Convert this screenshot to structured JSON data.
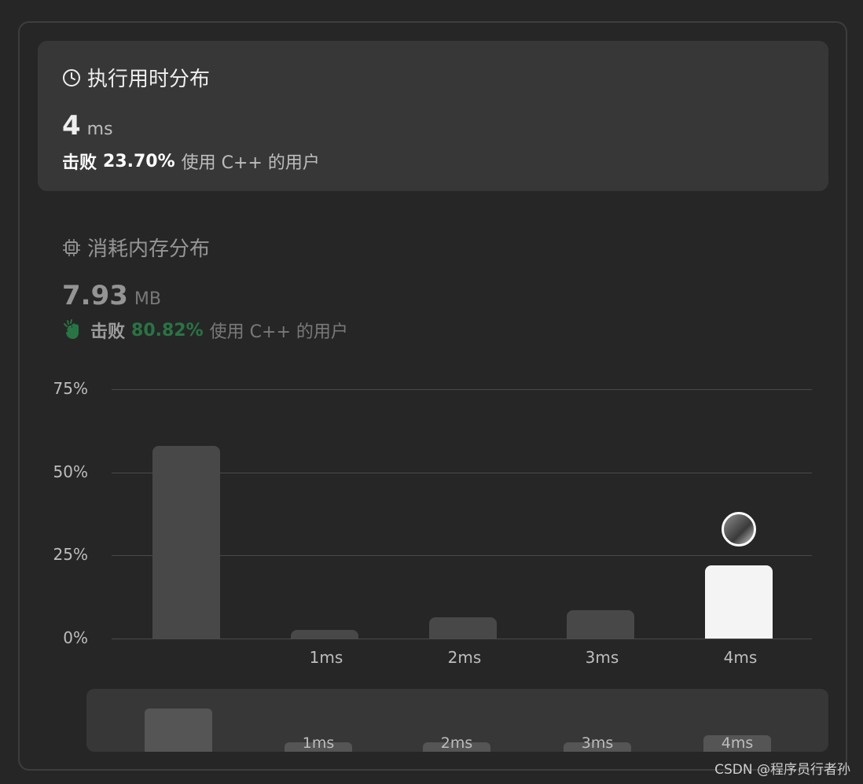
{
  "runtime": {
    "title": "执行用时分布",
    "icon": "clock-icon",
    "value": "4",
    "unit": "ms",
    "beat_label": "击败",
    "beat_percent": "23.70%",
    "beat_suffix": "使用 C++ 的用户"
  },
  "memory": {
    "title": "消耗内存分布",
    "icon": "chip-icon",
    "value": "7.93",
    "unit": "MB",
    "beat_icon": "clap-icon",
    "beat_label": "击败",
    "beat_percent": "80.82%",
    "beat_suffix": "使用 C++ 的用户"
  },
  "chart_data": {
    "type": "bar",
    "categories": [
      "",
      "1ms",
      "2ms",
      "3ms",
      "4ms"
    ],
    "values": [
      58,
      2.5,
      6.5,
      8.5,
      22
    ],
    "highlight_index": 4,
    "ylim": [
      0,
      75
    ],
    "yticks": [
      "75%",
      "50%",
      "25%",
      "0%"
    ],
    "ytick_values": [
      75,
      50,
      25,
      0
    ],
    "grid": true
  },
  "minimap": {
    "labels": [
      "",
      "1ms",
      "2ms",
      "3ms",
      "4ms"
    ]
  },
  "watermark": "CSDN @程序员行者孙",
  "colors": {
    "background": "#262626",
    "card": "#373737",
    "bar": "#484848",
    "bar_active": "#f4f4f4",
    "accent_green": "#2db55d"
  }
}
